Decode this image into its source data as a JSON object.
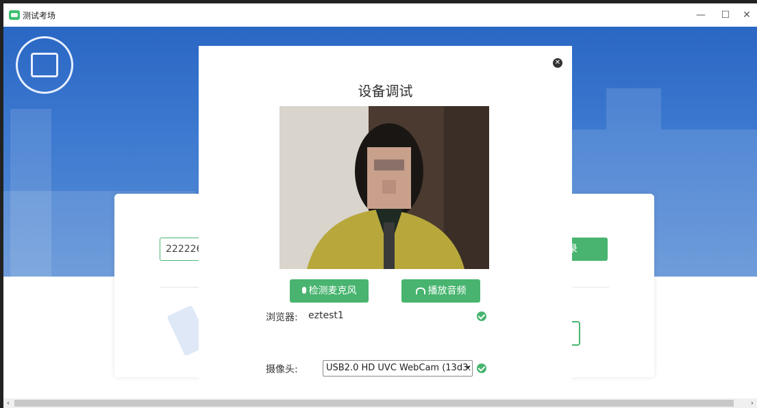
{
  "window": {
    "title": "测试考场",
    "minimize_glyph": "—",
    "maximize_glyph": "☐",
    "close_glyph": "✕"
  },
  "background": {
    "account_value": "222226",
    "login_label_partial": "录"
  },
  "modal": {
    "title": "设备调试",
    "close_glyph": "✕",
    "mic_button": "检测麦克风",
    "audio_button": "播放音频",
    "browser_label": "浏览器:",
    "browser_value": "eztest1",
    "camera_label": "摄像头:",
    "camera_selected": "USB2.0 HD UVC WebCam (13d3:"
  },
  "scroll": {
    "left_glyph": "‹",
    "right_glyph": "›"
  },
  "colors": {
    "accent": "#48b46f",
    "hero": "#2a67c4"
  },
  "icons": [
    "app-icon",
    "close-icon",
    "microphone-icon",
    "headphones-icon",
    "check-icon",
    "chevron-down-icon"
  ]
}
